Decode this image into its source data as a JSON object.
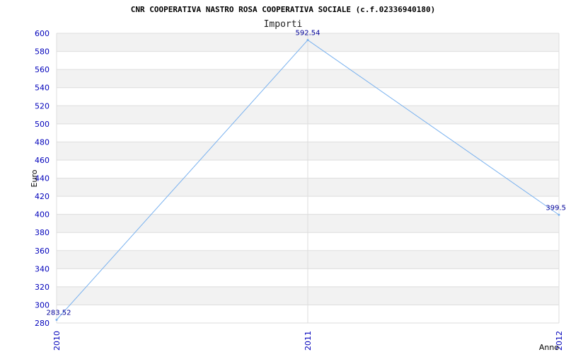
{
  "chart_data": {
    "type": "line",
    "title": "CNR COOPERATIVA NASTRO ROSA COOPERATIVA SOCIALE (c.f.02336940180)",
    "subtitle": "Importi",
    "xlabel": "Anno",
    "ylabel": "Euro",
    "categories": [
      "2010",
      "2011",
      "2012"
    ],
    "series": [
      {
        "values": [
          283.52,
          592.54,
          399.5
        ],
        "labels": [
          "283.52",
          "592.54",
          "399.5"
        ]
      }
    ],
    "ylim": [
      280,
      600
    ],
    "ytick_step": 20,
    "grid": true,
    "legend": "none",
    "colors": {
      "line": "#7ab2ef",
      "tick_text": "#0000bb",
      "data_label": "#000099",
      "band": "#f2f2f2",
      "grid": "#dddddd"
    }
  }
}
